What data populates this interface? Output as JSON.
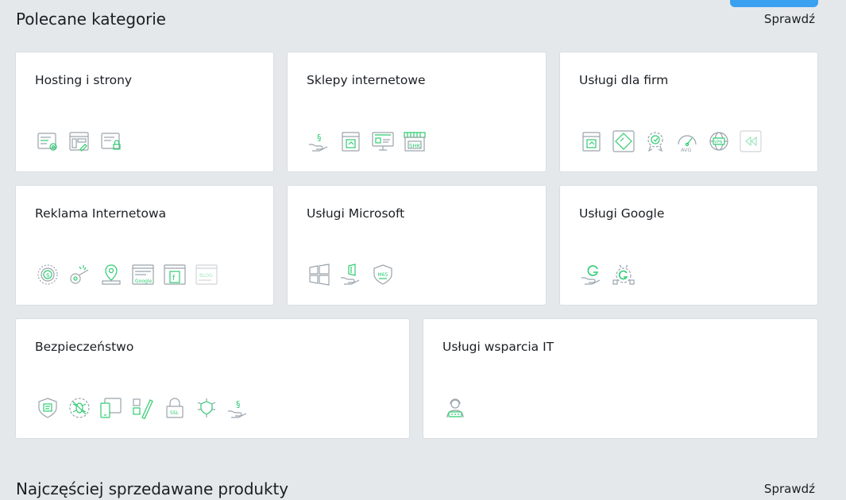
{
  "colors": {
    "accent": "#2ecc71",
    "background": "#e5e8eb",
    "card": "#ffffff",
    "top_button": "#3aa0f0"
  },
  "featured": {
    "title": "Polecane kategorie",
    "link": "Sprawdź",
    "cards": [
      {
        "title": "Hosting i strony",
        "icons": [
          "server-settings-icon",
          "website-edit-icon",
          "server-lock-icon"
        ]
      },
      {
        "title": "Sklepy internetowe",
        "icons": [
          "hand-paragraph-icon",
          "shop-window-icon",
          "monitor-shop-icon",
          "shop-awning-icon"
        ]
      },
      {
        "title": "Usługi dla firm",
        "icons": [
          "document-icon",
          "diamond-tag-icon",
          "badge-gear-icon",
          "speed-gauge-icon",
          "globe-vpn-icon",
          "rewind-icon"
        ]
      },
      {
        "title": "Reklama Internetowa",
        "icons": [
          "coin-target-icon",
          "megaphone-icon",
          "map-pin-icon",
          "google-ad-icon",
          "social-ad-icon",
          "blog-icon"
        ]
      },
      {
        "title": "Usługi Microsoft",
        "icons": [
          "windows-icon",
          "hand-office-icon",
          "shield-365-icon"
        ]
      },
      {
        "title": "Usługi Google",
        "icons": [
          "hand-google-icon",
          "google-gear-icon"
        ]
      },
      {
        "title": "Bezpieczeństwo",
        "icons": [
          "shield-document-icon",
          "bug-block-icon",
          "devices-icon",
          "check-edit-icon",
          "ssl-lock-icon",
          "shield-network-icon",
          "hand-paragraph-icon"
        ]
      },
      {
        "title": "Usługi wsparcia IT",
        "icons": [
          "support-agent-icon"
        ]
      }
    ]
  },
  "bestsellers": {
    "title": "Najczęściej sprzedawane produkty",
    "link": "Sprawdź"
  }
}
